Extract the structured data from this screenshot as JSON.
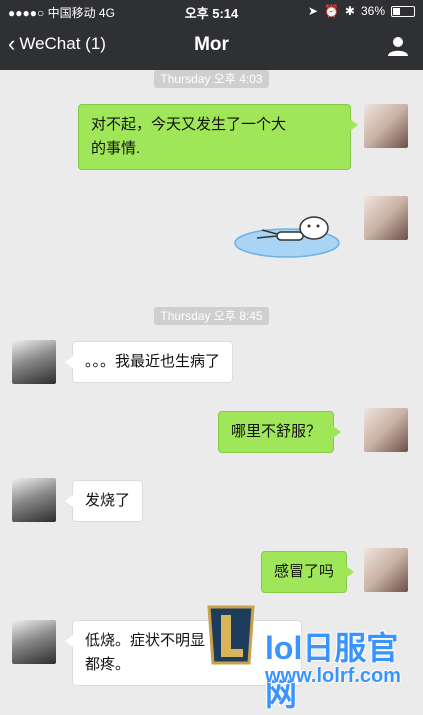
{
  "status_bar": {
    "carrier": "●●●●○ 中国移动",
    "network": "4G",
    "time": "오후 5:14",
    "battery": "36%",
    "battery_level": 0.36
  },
  "nav": {
    "back_label": "WeChat (1)",
    "title": "Mor"
  },
  "messages": {
    "time1": "Thursday 오후 4:03",
    "msg1": [
      "对不起，今天又发生了一个大",
      "的事情."
    ],
    "time2": "Thursday 오후 8:45",
    "msg3": "。。。我最近也生病了",
    "msg4": "哪里不舒服？",
    "msg5": "发烧了",
    "msg6": "感冒了吗",
    "msg7": [
      "低烧。症状不明显",
      "都疼。"
    ]
  },
  "watermark": {
    "text": "lol日服官网",
    "url": "www.lolrf.com"
  },
  "colors": {
    "bar": "#2f3033",
    "bubble_me": "#9fe658",
    "bubble_them": "#ffffff",
    "background": "#ebebeb"
  }
}
